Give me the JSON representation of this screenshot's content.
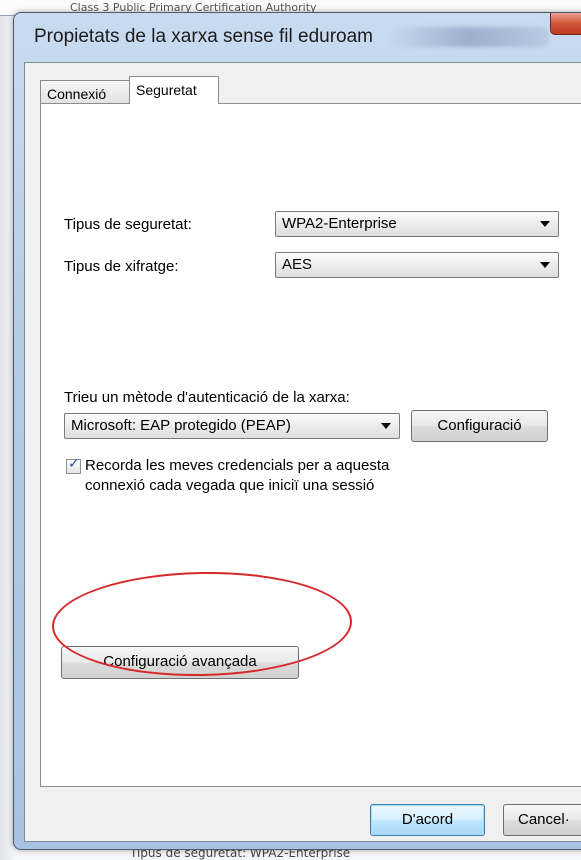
{
  "background": {
    "top_text": "Class 3 Public Primary Certification Authority",
    "bottom_text": "Tipus de seguretat: WPA2-Enterprise"
  },
  "dialog": {
    "title": "Propietats de la xarxa sense fil eduroam"
  },
  "tabs": [
    {
      "label": "Connexió",
      "active": false
    },
    {
      "label": "Seguretat",
      "active": true
    }
  ],
  "security": {
    "security_type_label": "Tipus de seguretat:",
    "security_type_value": "WPA2-Enterprise",
    "encryption_type_label": "Tipus de xifratge:",
    "encryption_type_value": "AES",
    "auth_method_label": "Trieu un mètode d'autenticació de la xarxa:",
    "auth_method_value": "Microsoft: EAP protegido (PEAP)",
    "configure_label": "Configuració",
    "remember_line1": "Recorda les meves credencials per a aquesta",
    "remember_line2": "connexió cada vegada que iniciï una sessió",
    "remember_checked": true,
    "advanced_label": "Configuració avançada"
  },
  "footer": {
    "ok_label": "D'acord",
    "cancel_label": "Cancel·"
  },
  "colors": {
    "highlight_ellipse": "#d62a2a",
    "close_button": "#c0391f"
  }
}
